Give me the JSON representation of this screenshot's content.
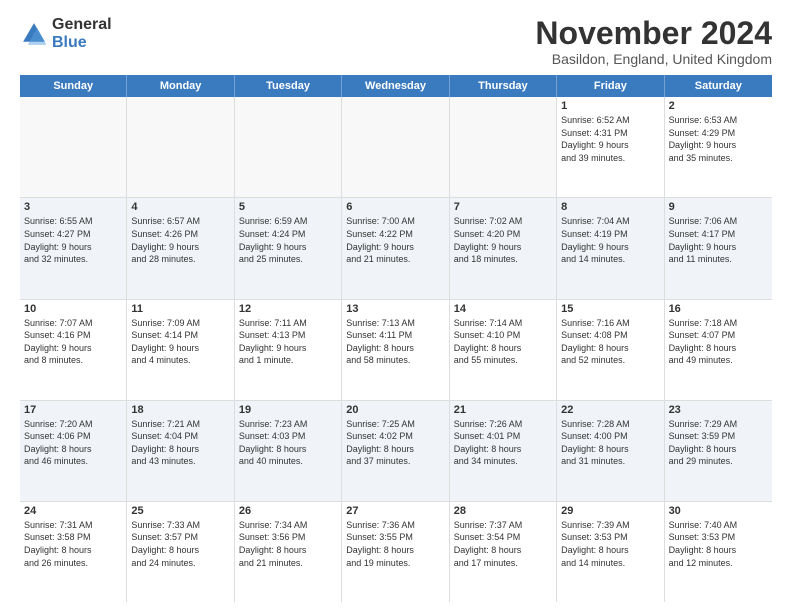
{
  "logo": {
    "general": "General",
    "blue": "Blue"
  },
  "title": "November 2024",
  "location": "Basildon, England, United Kingdom",
  "headers": [
    "Sunday",
    "Monday",
    "Tuesday",
    "Wednesday",
    "Thursday",
    "Friday",
    "Saturday"
  ],
  "rows": [
    [
      {
        "day": "",
        "info": "",
        "empty": true
      },
      {
        "day": "",
        "info": "",
        "empty": true
      },
      {
        "day": "",
        "info": "",
        "empty": true
      },
      {
        "day": "",
        "info": "",
        "empty": true
      },
      {
        "day": "",
        "info": "",
        "empty": true
      },
      {
        "day": "1",
        "info": "Sunrise: 6:52 AM\nSunset: 4:31 PM\nDaylight: 9 hours\nand 39 minutes.",
        "empty": false
      },
      {
        "day": "2",
        "info": "Sunrise: 6:53 AM\nSunset: 4:29 PM\nDaylight: 9 hours\nand 35 minutes.",
        "empty": false
      }
    ],
    [
      {
        "day": "3",
        "info": "Sunrise: 6:55 AM\nSunset: 4:27 PM\nDaylight: 9 hours\nand 32 minutes.",
        "empty": false
      },
      {
        "day": "4",
        "info": "Sunrise: 6:57 AM\nSunset: 4:26 PM\nDaylight: 9 hours\nand 28 minutes.",
        "empty": false
      },
      {
        "day": "5",
        "info": "Sunrise: 6:59 AM\nSunset: 4:24 PM\nDaylight: 9 hours\nand 25 minutes.",
        "empty": false
      },
      {
        "day": "6",
        "info": "Sunrise: 7:00 AM\nSunset: 4:22 PM\nDaylight: 9 hours\nand 21 minutes.",
        "empty": false
      },
      {
        "day": "7",
        "info": "Sunrise: 7:02 AM\nSunset: 4:20 PM\nDaylight: 9 hours\nand 18 minutes.",
        "empty": false
      },
      {
        "day": "8",
        "info": "Sunrise: 7:04 AM\nSunset: 4:19 PM\nDaylight: 9 hours\nand 14 minutes.",
        "empty": false
      },
      {
        "day": "9",
        "info": "Sunrise: 7:06 AM\nSunset: 4:17 PM\nDaylight: 9 hours\nand 11 minutes.",
        "empty": false
      }
    ],
    [
      {
        "day": "10",
        "info": "Sunrise: 7:07 AM\nSunset: 4:16 PM\nDaylight: 9 hours\nand 8 minutes.",
        "empty": false
      },
      {
        "day": "11",
        "info": "Sunrise: 7:09 AM\nSunset: 4:14 PM\nDaylight: 9 hours\nand 4 minutes.",
        "empty": false
      },
      {
        "day": "12",
        "info": "Sunrise: 7:11 AM\nSunset: 4:13 PM\nDaylight: 9 hours\nand 1 minute.",
        "empty": false
      },
      {
        "day": "13",
        "info": "Sunrise: 7:13 AM\nSunset: 4:11 PM\nDaylight: 8 hours\nand 58 minutes.",
        "empty": false
      },
      {
        "day": "14",
        "info": "Sunrise: 7:14 AM\nSunset: 4:10 PM\nDaylight: 8 hours\nand 55 minutes.",
        "empty": false
      },
      {
        "day": "15",
        "info": "Sunrise: 7:16 AM\nSunset: 4:08 PM\nDaylight: 8 hours\nand 52 minutes.",
        "empty": false
      },
      {
        "day": "16",
        "info": "Sunrise: 7:18 AM\nSunset: 4:07 PM\nDaylight: 8 hours\nand 49 minutes.",
        "empty": false
      }
    ],
    [
      {
        "day": "17",
        "info": "Sunrise: 7:20 AM\nSunset: 4:06 PM\nDaylight: 8 hours\nand 46 minutes.",
        "empty": false
      },
      {
        "day": "18",
        "info": "Sunrise: 7:21 AM\nSunset: 4:04 PM\nDaylight: 8 hours\nand 43 minutes.",
        "empty": false
      },
      {
        "day": "19",
        "info": "Sunrise: 7:23 AM\nSunset: 4:03 PM\nDaylight: 8 hours\nand 40 minutes.",
        "empty": false
      },
      {
        "day": "20",
        "info": "Sunrise: 7:25 AM\nSunset: 4:02 PM\nDaylight: 8 hours\nand 37 minutes.",
        "empty": false
      },
      {
        "day": "21",
        "info": "Sunrise: 7:26 AM\nSunset: 4:01 PM\nDaylight: 8 hours\nand 34 minutes.",
        "empty": false
      },
      {
        "day": "22",
        "info": "Sunrise: 7:28 AM\nSunset: 4:00 PM\nDaylight: 8 hours\nand 31 minutes.",
        "empty": false
      },
      {
        "day": "23",
        "info": "Sunrise: 7:29 AM\nSunset: 3:59 PM\nDaylight: 8 hours\nand 29 minutes.",
        "empty": false
      }
    ],
    [
      {
        "day": "24",
        "info": "Sunrise: 7:31 AM\nSunset: 3:58 PM\nDaylight: 8 hours\nand 26 minutes.",
        "empty": false
      },
      {
        "day": "25",
        "info": "Sunrise: 7:33 AM\nSunset: 3:57 PM\nDaylight: 8 hours\nand 24 minutes.",
        "empty": false
      },
      {
        "day": "26",
        "info": "Sunrise: 7:34 AM\nSunset: 3:56 PM\nDaylight: 8 hours\nand 21 minutes.",
        "empty": false
      },
      {
        "day": "27",
        "info": "Sunrise: 7:36 AM\nSunset: 3:55 PM\nDaylight: 8 hours\nand 19 minutes.",
        "empty": false
      },
      {
        "day": "28",
        "info": "Sunrise: 7:37 AM\nSunset: 3:54 PM\nDaylight: 8 hours\nand 17 minutes.",
        "empty": false
      },
      {
        "day": "29",
        "info": "Sunrise: 7:39 AM\nSunset: 3:53 PM\nDaylight: 8 hours\nand 14 minutes.",
        "empty": false
      },
      {
        "day": "30",
        "info": "Sunrise: 7:40 AM\nSunset: 3:53 PM\nDaylight: 8 hours\nand 12 minutes.",
        "empty": false
      }
    ]
  ]
}
